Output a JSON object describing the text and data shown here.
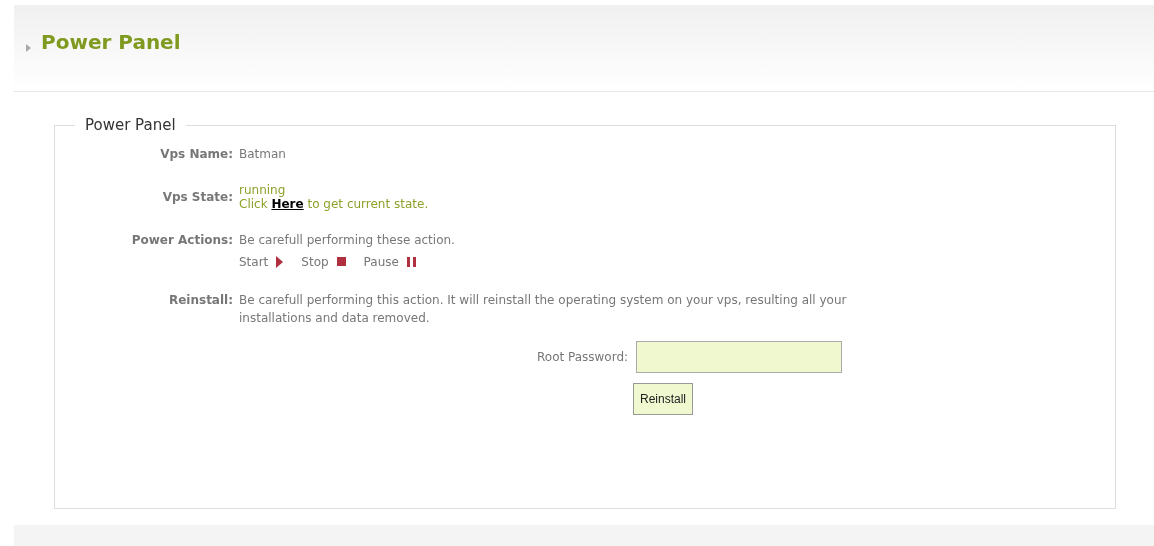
{
  "page_title": "Power Panel",
  "panel": {
    "legend": "Power Panel",
    "fields": [
      {
        "kind": "text",
        "label": "Vps Name:",
        "value": "Batman"
      },
      {
        "kind": "state",
        "label": "Vps State:",
        "value": "running",
        "hint_before": "Click",
        "link": "Here",
        "hint_after": "to get current state."
      },
      {
        "kind": "actions",
        "label": "Power Actions:",
        "value": "Be carefull performing these action.",
        "actions": [
          {
            "kind": "start",
            "label": "Start"
          },
          {
            "kind": "stop",
            "label": "Stop"
          },
          {
            "kind": "pause",
            "label": "Pause"
          }
        ]
      },
      {
        "kind": "text",
        "label": "Reinstall:",
        "value": "Be carefull performing this action. It will reinstall the operating system on your vps, resulting all your installations and data removed."
      }
    ],
    "password_label": "Root Password:",
    "button": "Reinstall"
  }
}
